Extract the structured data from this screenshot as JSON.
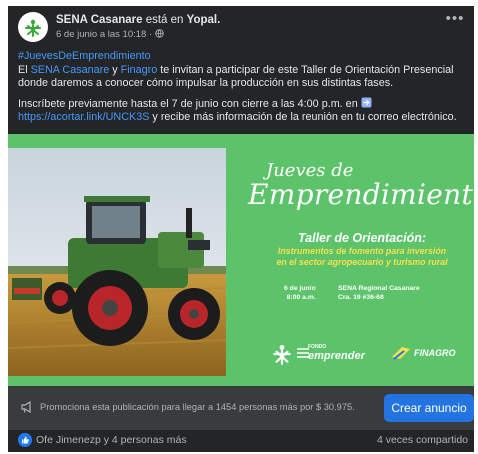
{
  "post": {
    "page_name": "SENA Casanare",
    "location_connector": "está en",
    "location": "Yopal.",
    "timestamp": "6 de junio a las 10:18",
    "separator": "·",
    "hashtag": "#JuevesDeEmprendimiento",
    "line1_prefix": "El",
    "line1_link1": "SENA Casanare",
    "line1_and": "y",
    "line1_link2": "Finagro",
    "line1_rest": "te invitan a participar de este Taller de Orientación Presencial",
    "line2": "donde daremos a conocer cómo impulsar la producción en sus distintas fases.",
    "line3": "Inscríbete previamente hasta el 7 de junio con cierre a las 4:00 p.m. en",
    "line4_link": "https://acortar.link/UNCK3S",
    "line4_rest": "y recibe más información de la reunión en tu correo electrónico."
  },
  "banner": {
    "jueves": "Jueves de",
    "emprendimiento": "Emprendimiento",
    "taller": "Taller de Orientación:",
    "instrumentos_1": "Instrumentos de fomento para inversión",
    "instrumentos_2": "en el sector agropecuario y turismo rural",
    "fecha_1": "6 de junio",
    "fecha_2": "8:00 a.m.",
    "lugar_1": "SENA Regional Casanare",
    "lugar_2": "Cra. 19 #36-68",
    "fondo_small": "FONDO",
    "fondo_big": "emprender",
    "finagro": "FINAGRO"
  },
  "promo": {
    "text": "Promociona esta publicación para llegar a 1454 personas más por $ 30.975.",
    "button": "Crear anuncio"
  },
  "reactions": {
    "text": "Ofe Jimenezp y 4 personas más",
    "shares": "4 veces compartido"
  },
  "colors": {
    "card_bg": "#242526",
    "link": "#4599ff",
    "banner_green": "#5cc36a",
    "cta_blue": "#2374e1",
    "highlight_yellow": "#f7e14a"
  },
  "icons": [
    "sena-logo-icon",
    "globe-icon",
    "more-options-icon",
    "arrow-emoji-icon",
    "megaphone-icon",
    "like-icon"
  ]
}
